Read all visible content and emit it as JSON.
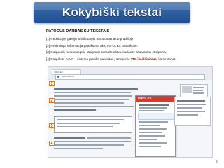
{
  "slide": {
    "title": "Kokybiški tekstai",
    "heading": "PATOGUS DARBAS SU TEKSTAIS",
    "steps": [
      {
        "num": "[1]",
        "text": "Redakcijos galiojimo laikotarpis nurodomas akto pradžioje."
      },
      {
        "num": "[2]",
        "text": "Pirkliminga informacija pateikiama aktų INFOLEX paslaikose."
      },
      {
        "num": "[3]",
        "text": "Paspaudę nuorodas prie straipsnio surasite aktus, kuriuose cituojamas straipsnis."
      },
      {
        "num": "[4]",
        "text_before": "Paspirkite „VMI“ – sistema pateiks nuorodas į straipsnio",
        "highlight": "VMI išaiškinimus",
        "text_after": ", komentarus."
      }
    ],
    "page_number": "6"
  },
  "screenshot": {
    "tab_label": "INFOLEX",
    "address_text": "www.infolex.lt",
    "popup_brand": "INFOLEX",
    "badges": [
      "1",
      "2",
      "3",
      "4"
    ]
  }
}
